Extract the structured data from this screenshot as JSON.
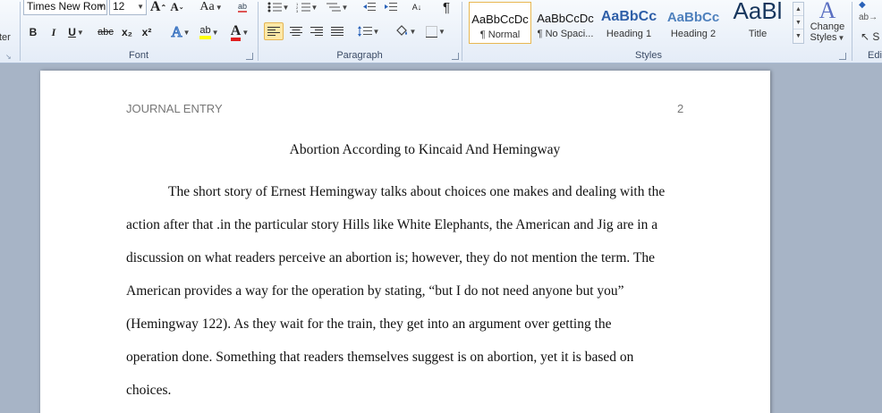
{
  "ribbon": {
    "clipboard": {
      "partial_label": "ter"
    },
    "font": {
      "group_label": "Font",
      "font_name": "Times New Rom",
      "font_size": "12",
      "grow": "A",
      "shrink": "A",
      "change_case": "Aa",
      "bold": "B",
      "italic": "I",
      "underline": "U",
      "strikethrough": "abc",
      "subscript": "x₂",
      "superscript": "x²",
      "text_effects": "A",
      "highlight": "ab",
      "font_color": "A"
    },
    "paragraph": {
      "group_label": "Paragraph"
    },
    "styles": {
      "group_label": "Styles",
      "tiles": [
        {
          "preview": "AaBbCcDc",
          "name": "¶ Normal"
        },
        {
          "preview": "AaBbCcDc",
          "name": "¶ No Spaci..."
        },
        {
          "preview": "AaBbCc",
          "name": "Heading 1"
        },
        {
          "preview": "AaBbCc",
          "name": "Heading 2"
        },
        {
          "preview": "AaBl",
          "name": "Title"
        }
      ],
      "change_styles_line1": "Change",
      "change_styles_line2": "Styles"
    },
    "editing": {
      "partial_label": "Edi"
    }
  },
  "document": {
    "header_left": "JOURNAL ENTRY",
    "header_right": "2",
    "title": "Abortion According to Kincaid And Hemingway",
    "lines": [
      "The short story of Ernest Hemingway talks about choices one makes and dealing with the",
      "action after that .in the particular  story Hills like White Elephants, the American and Jig are in a",
      "discussion on what readers perceive an abortion is; however, they do not mention the term. The",
      "American provides a way for the operation by stating, “but I do not need anyone but you”",
      "(Hemingway 122). As they wait for the train, they get into an argument over getting the",
      "operation done. Something that readers themselves suggest is on abortion, yet it is based on",
      "choices."
    ]
  },
  "colors": {
    "ribbon_bg": "#e4ecf7",
    "workspace_bg": "#a7b4c6",
    "highlight_yellow": "#ffff00",
    "font_color_red": "#e02020",
    "heading_blue": "#2f5fa8"
  }
}
